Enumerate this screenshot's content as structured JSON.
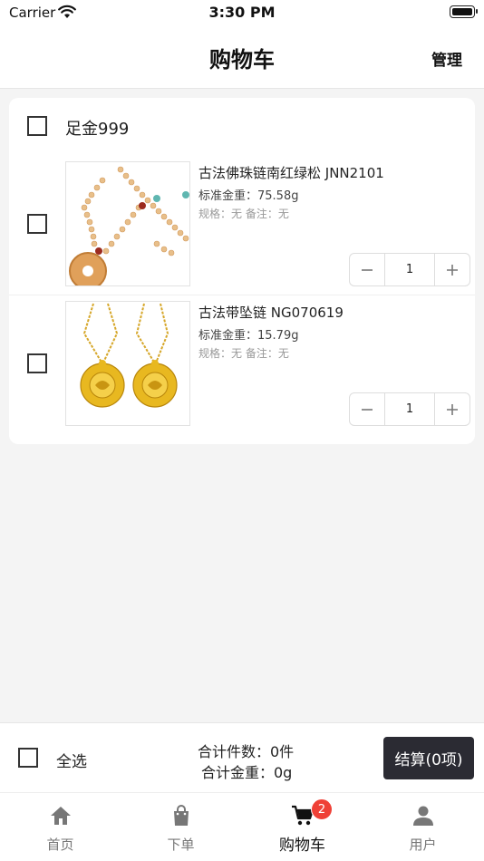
{
  "status_bar": {
    "carrier": "Carrier",
    "time": "3:30 PM"
  },
  "nav": {
    "title": "购物车",
    "manage_label": "管理"
  },
  "cart": {
    "group_title": "足金999",
    "items": [
      {
        "name": "古法佛珠链南红绿松 JNN2101",
        "weight": "标准金重：75.58g",
        "spec": "规格：无  备注：无",
        "quantity": "1",
        "image_icon": "beaded-necklace-photo"
      },
      {
        "name": "古法带坠链 NG070619",
        "weight": "标准金重：15.79g",
        "spec": "规格：无  备注：无",
        "quantity": "1",
        "image_icon": "gold-pendant-chain-photo"
      }
    ]
  },
  "summary": {
    "select_all_label": "全选",
    "total_count": "合计件数：0件",
    "total_weight": "合计金重：0g",
    "checkout_label": "结算(0项)"
  },
  "tabbar": {
    "tabs": [
      {
        "label": "首页",
        "icon": "home-icon"
      },
      {
        "label": "下单",
        "icon": "shopping-bag-icon"
      },
      {
        "label": "购物车",
        "icon": "cart-icon",
        "badge": "2",
        "active": true
      },
      {
        "label": "用户",
        "icon": "user-icon"
      }
    ]
  },
  "colors": {
    "badge": "#ef4036",
    "checkout_bg": "#2b2b33",
    "background": "#f4f4f4"
  }
}
